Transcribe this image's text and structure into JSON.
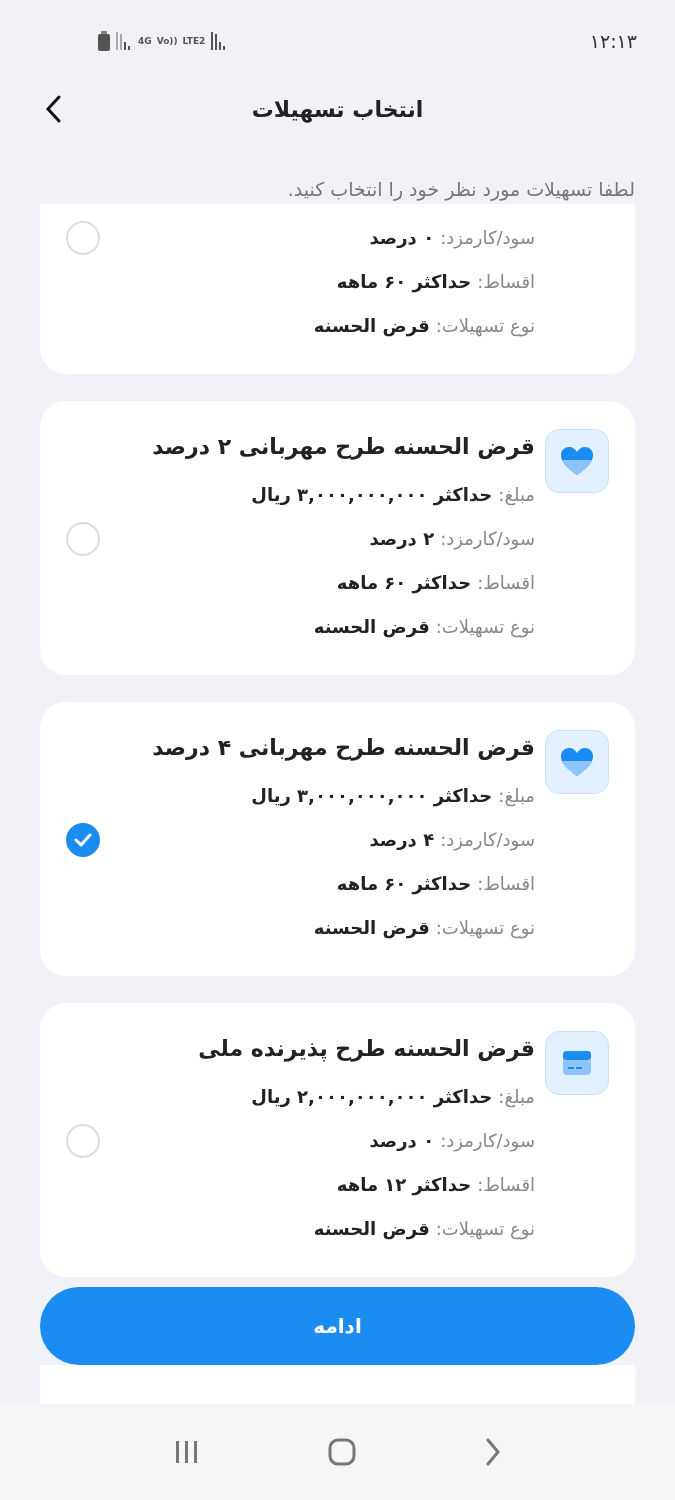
{
  "status_bar": {
    "time": "۱۲:۱۳",
    "network_labels": [
      "LTE2",
      "Vo))",
      "4G"
    ]
  },
  "header": {
    "title": "انتخاب تسهیلات"
  },
  "instruction": "لطفا تسهیلات مورد نظر خود را انتخاب کنید.",
  "cards": [
    {
      "selected": false,
      "rows": [
        {
          "label": "سود/کارمزد:",
          "value": "۰ درصد"
        },
        {
          "label": "اقساط:",
          "value": "حداکثر ۶۰ ماهه"
        },
        {
          "label": "نوع تسهیلات:",
          "value": "قرض الحسنه"
        }
      ]
    },
    {
      "selected": false,
      "kind": "heart",
      "title": "قرض الحسنه طرح مهربانی ۲ درصد",
      "rows": [
        {
          "label": "مبلغ:",
          "value": "حداکثر ۳,۰۰۰,۰۰۰,۰۰۰ ریال"
        },
        {
          "label": "سود/کارمزد:",
          "value": "۲ درصد"
        },
        {
          "label": "اقساط:",
          "value": "حداکثر ۶۰ ماهه"
        },
        {
          "label": "نوع تسهیلات:",
          "value": "قرض الحسنه"
        }
      ]
    },
    {
      "selected": true,
      "kind": "heart",
      "title": "قرض الحسنه طرح مهربانی ۴ درصد",
      "rows": [
        {
          "label": "مبلغ:",
          "value": "حداکثر ۳,۰۰۰,۰۰۰,۰۰۰ ریال"
        },
        {
          "label": "سود/کارمزد:",
          "value": "۴ درصد"
        },
        {
          "label": "اقساط:",
          "value": "حداکثر ۶۰ ماهه"
        },
        {
          "label": "نوع تسهیلات:",
          "value": "قرض الحسنه"
        }
      ]
    },
    {
      "selected": false,
      "kind": "card",
      "title": "قرض الحسنه طرح پذیرنده ملی",
      "rows": [
        {
          "label": "مبلغ:",
          "value": "حداکثر ۲,۰۰۰,۰۰۰,۰۰۰ ریال"
        },
        {
          "label": "سود/کارمزد:",
          "value": "۰ درصد"
        },
        {
          "label": "اقساط:",
          "value": "حداکثر ۱۲ ماهه"
        },
        {
          "label": "نوع تسهیلات:",
          "value": "قرض الحسنه"
        }
      ]
    }
  ],
  "continue_button": "ادامه"
}
